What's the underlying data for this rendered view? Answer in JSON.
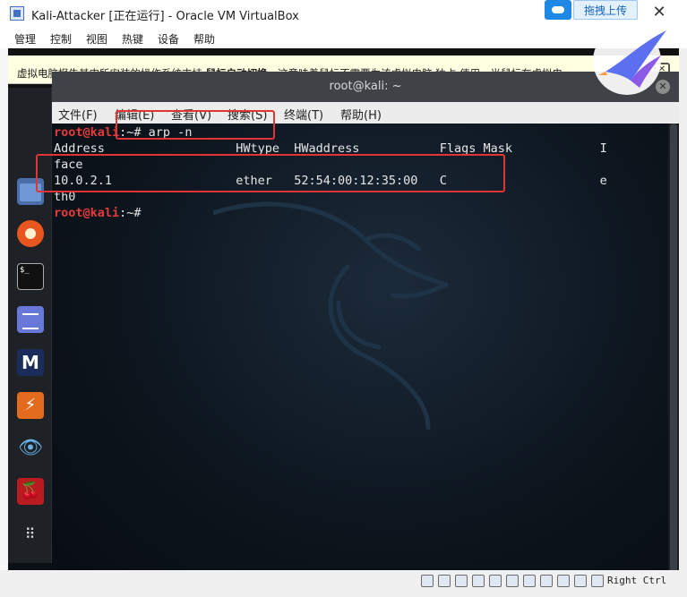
{
  "window": {
    "title": "Kali-Attacker [正在运行] - Oracle VM VirtualBox",
    "upload_button": "拖拽上传",
    "close_glyph": "✕"
  },
  "vbox_menu": [
    "管理",
    "控制",
    "视图",
    "热键",
    "设备",
    "帮助"
  ],
  "notice": {
    "text_before": "虚拟电脑报告其内所安装的操作系统支持 ",
    "text_bold": "鼠标自动切换",
    "text_after": "。这意味着鼠标不需要为该虚拟电脑 独占 使用，当鼠标在虚拟电",
    "close_glyph": "✕"
  },
  "terminal": {
    "title": "root@kali: ~",
    "close_glyph": "✕",
    "menu": [
      "文件(F)",
      "编辑(E)",
      "查看(V)",
      "搜索(S)",
      "终端(T)",
      "帮助(H)"
    ],
    "prompt_user": "root@kali",
    "prompt_suffix": ":~#",
    "command": " arp -n",
    "header": "Address                  HWtype  HWaddress           Flags Mask            I",
    "wrap_1": "face",
    "entry": "10.0.2.1                 ether   52:54:00:12:35:00   C                     e",
    "wrap_2": "th0"
  },
  "dock": {
    "terminal_glyph": "$_",
    "metasploit_glyph": "M",
    "burp_glyph": "⚡",
    "eye_glyph": "👁",
    "cherry_glyph": "🍒",
    "apps_glyph": "⠿"
  },
  "status": {
    "host_key": "Right Ctrl"
  }
}
